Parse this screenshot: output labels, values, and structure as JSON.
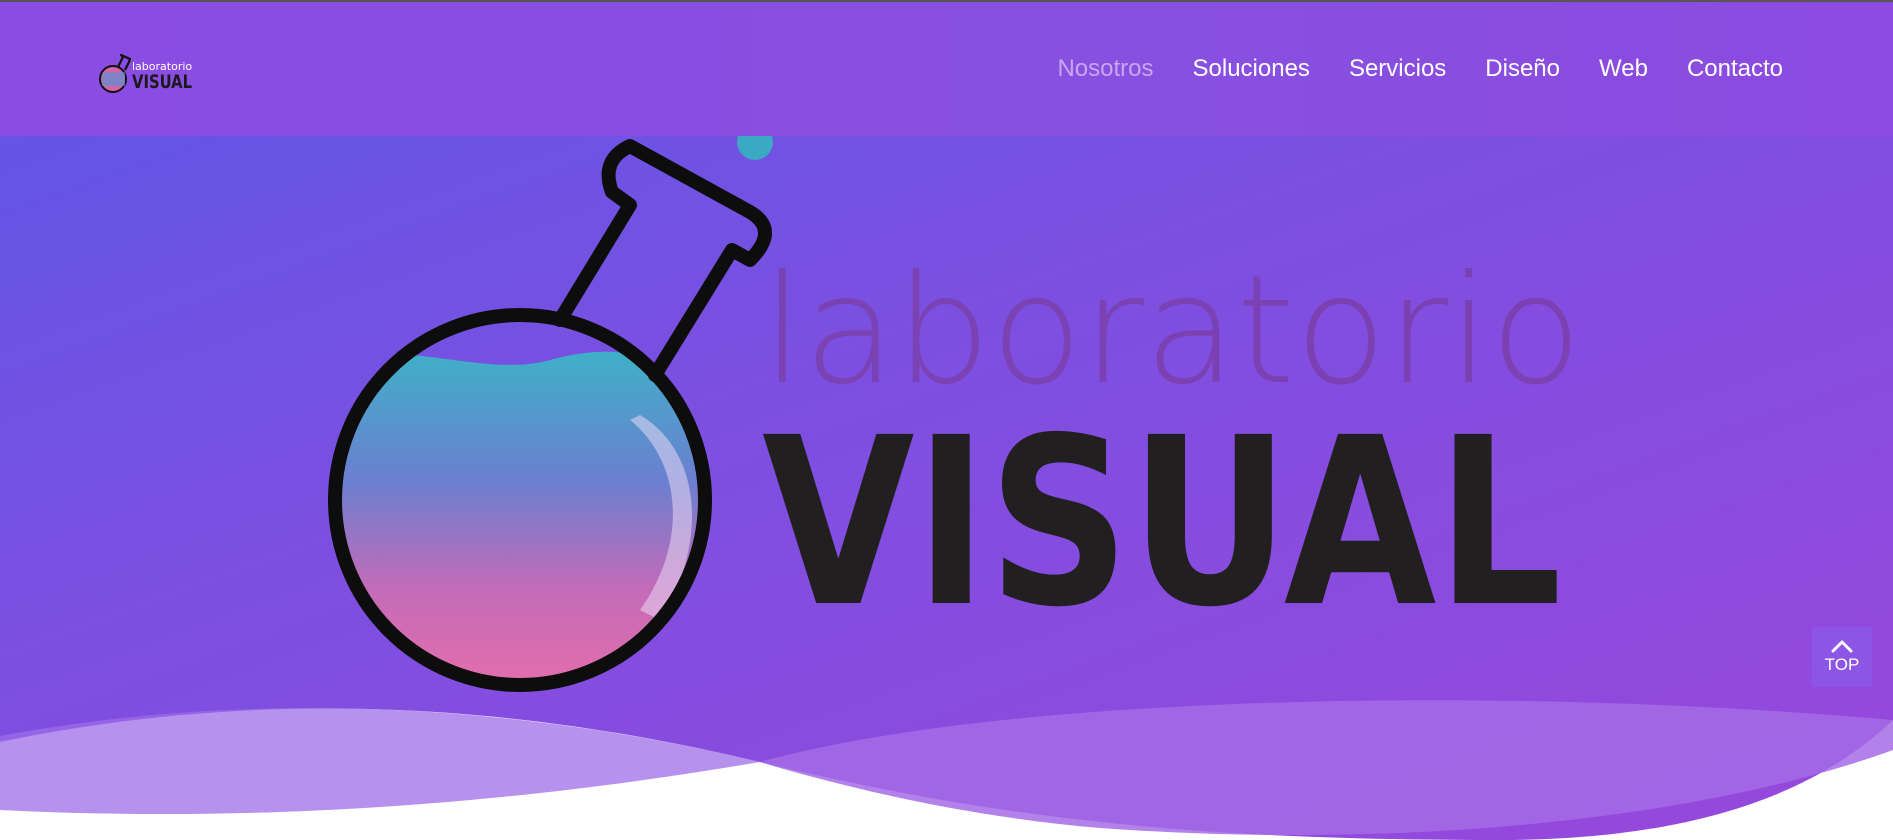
{
  "brand": {
    "small_word": "laboratorio",
    "big_word": "VISUAL"
  },
  "nav": {
    "items": [
      {
        "label": "Nosotros",
        "active": true
      },
      {
        "label": "Soluciones",
        "active": false
      },
      {
        "label": "Servicios",
        "active": false
      },
      {
        "label": "Diseño",
        "active": false
      },
      {
        "label": "Web",
        "active": false
      },
      {
        "label": "Contacto",
        "active": false
      }
    ]
  },
  "top_button": {
    "label": "TOP",
    "icon": "chevron-up-icon"
  },
  "colors": {
    "accent": "#8a4ce2",
    "active_link": "#c8a6f0",
    "logo_dark": "#221f20",
    "logo_light_word": "#7a3fa8"
  }
}
